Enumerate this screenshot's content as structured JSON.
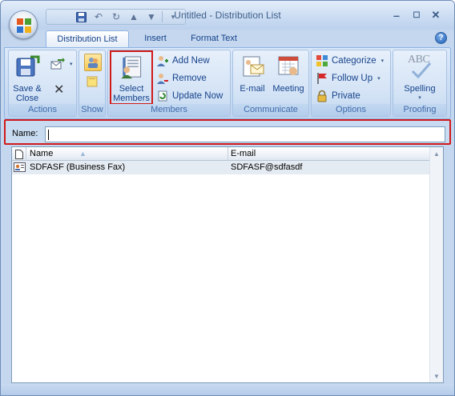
{
  "window": {
    "title": "Untitled - Distribution List",
    "quick_access": [
      "save-icon",
      "undo-icon",
      "redo-icon",
      "previous-item-icon",
      "next-item-icon",
      "customize-dropdown-icon"
    ],
    "controls": {
      "minimize": "‒",
      "maximize": "☐",
      "close": "✕"
    }
  },
  "tabs": [
    {
      "label": "Distribution List",
      "active": true
    },
    {
      "label": "Insert",
      "active": false
    },
    {
      "label": "Format Text",
      "active": false
    }
  ],
  "ribbon": {
    "actions": {
      "label": "Actions",
      "save_close": "Save &",
      "save_close_2": "Close",
      "delete": "✕"
    },
    "show": {
      "label": "Show"
    },
    "members": {
      "label": "Members",
      "select_members": "Select",
      "select_members_2": "Members",
      "add_new": "Add New",
      "remove": "Remove",
      "update_now": "Update Now"
    },
    "communicate": {
      "label": "Communicate",
      "email": "E-mail",
      "meeting": "Meeting"
    },
    "options": {
      "label": "Options",
      "categorize": "Categorize",
      "follow_up": "Follow Up",
      "private": "Private"
    },
    "proofing": {
      "label": "Proofing",
      "spelling": "Spelling",
      "abc": "ABC"
    }
  },
  "name_field": {
    "label": "Name:",
    "value": ""
  },
  "members_list": {
    "columns": [
      {
        "label": "Name",
        "sorted": "ascending"
      },
      {
        "label": "E-mail"
      }
    ],
    "rows": [
      {
        "name": "SDFASF (Business Fax)",
        "email": "SDFASF@sdfasdf"
      }
    ]
  },
  "colors": {
    "highlight": "#d01a1a",
    "ribbon": "#c8dbf2",
    "text": "#15428b"
  }
}
